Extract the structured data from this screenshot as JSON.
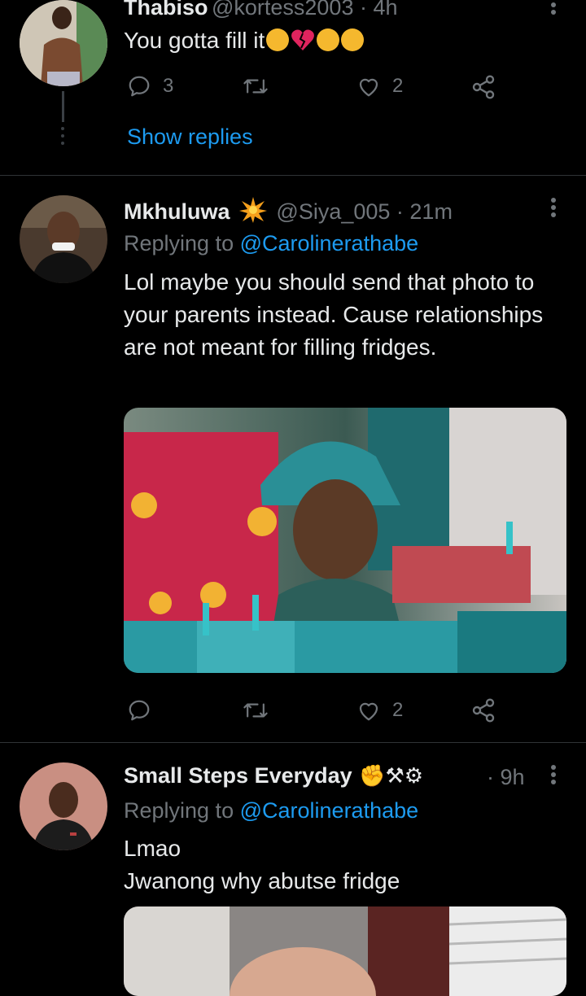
{
  "tweet1": {
    "name": "Thabiso",
    "handle_time": "@kortess2003 · 4h",
    "text": "You gotta fill it",
    "emojis": [
      "crying-face",
      "broken-heart",
      "tears-of-joy",
      "tears-of-joy"
    ],
    "reply_count": "3",
    "like_count": "2",
    "show_replies": "Show replies"
  },
  "tweet2": {
    "name": "Mkhuluwa",
    "name_badge": "sparkle-emoji",
    "handle_time": "@Siya_005 · 21m",
    "replying_prefix": "Replying to",
    "replying_to": "@Carolinerathabe",
    "text": "Lol maybe you should send that photo to your parents instead. Cause relationships are not meant for filling fridges.",
    "like_count": "2",
    "image_alt": "Elderly man in teal bucket hat hanging laundry on a line"
  },
  "tweet3": {
    "name": "Small Steps Everyday",
    "name_badges": "✊⚒⚙",
    "time": "· 9h",
    "replying_prefix": "Replying to",
    "replying_to": "@Carolinerathabe",
    "text_line1": "Lmao",
    "text_line2": "Jwanong why abutse fridge"
  },
  "colors": {
    "background": "#000000",
    "text": "#e7e9ea",
    "secondary": "#71767b",
    "link": "#1d9bf0",
    "divider": "#2f3336"
  }
}
